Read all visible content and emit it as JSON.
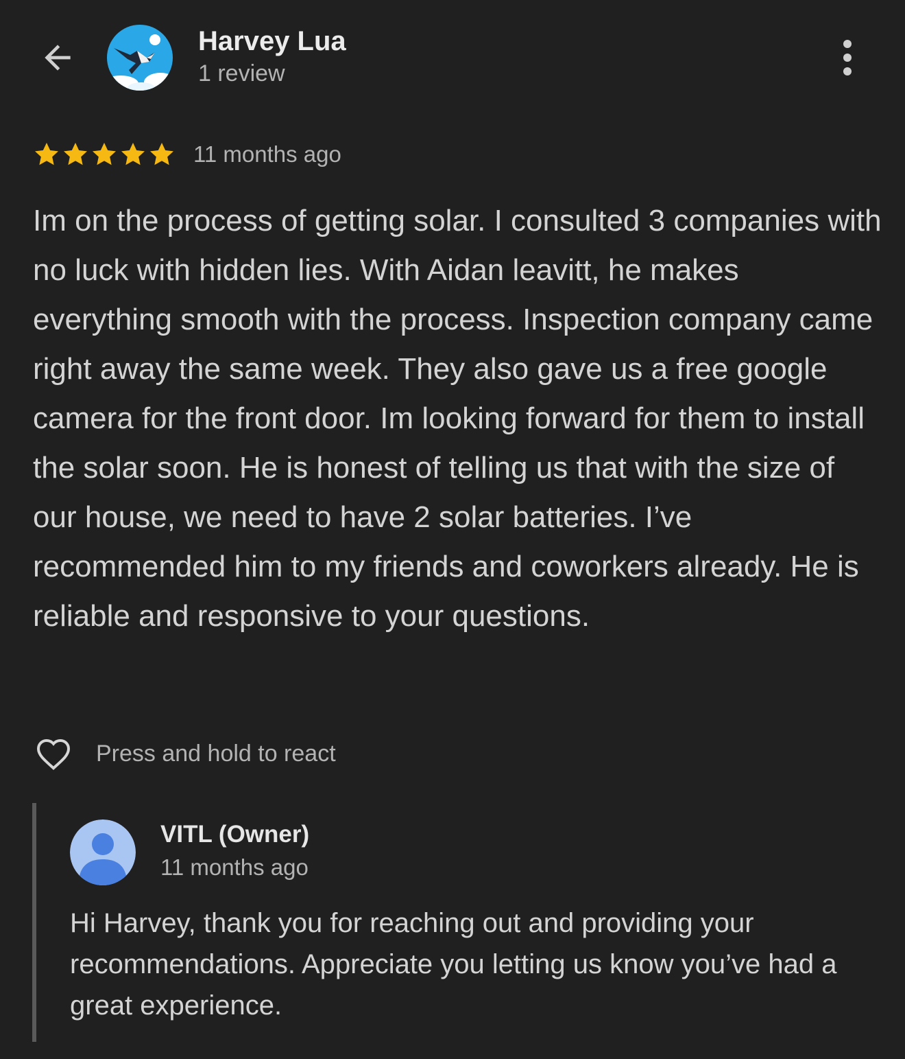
{
  "colors": {
    "background": "#202020",
    "star": "#f6b913",
    "owner_avatar_bg": "#a9c5f2",
    "owner_avatar_fg": "#4a80e0",
    "reply_bar": "#5a5a5a"
  },
  "header": {
    "back_icon": "arrow-left-icon",
    "avatar_icon": "bird-avatar",
    "reviewer_name": "Harvey Lua",
    "reviewer_meta": "1 review",
    "more_icon": "more-vert-icon"
  },
  "review": {
    "rating": 5,
    "max_rating": 5,
    "time": "11 months ago",
    "text": "Im on the process of getting solar. I consulted 3 companies with no luck with hidden lies. With Aidan leavitt, he makes everything smooth with the process. Inspection company came right away the same week. They also gave us a free google camera for the front door. Im looking forward for them to install the solar soon. He is honest of telling us that with the size of our house, we need to have 2 solar batteries. I’ve recommended him to my friends and coworkers already. He is reliable and responsive to your questions."
  },
  "react": {
    "icon": "heart-outline-icon",
    "label": "Press and hold to react"
  },
  "owner_reply": {
    "avatar_icon": "person-avatar-icon",
    "name": "VITL (Owner)",
    "time": "11 months ago",
    "text": "Hi Harvey, thank you for reaching out and providing your recommendations. Appreciate you letting us know you’ve had a great experience."
  }
}
